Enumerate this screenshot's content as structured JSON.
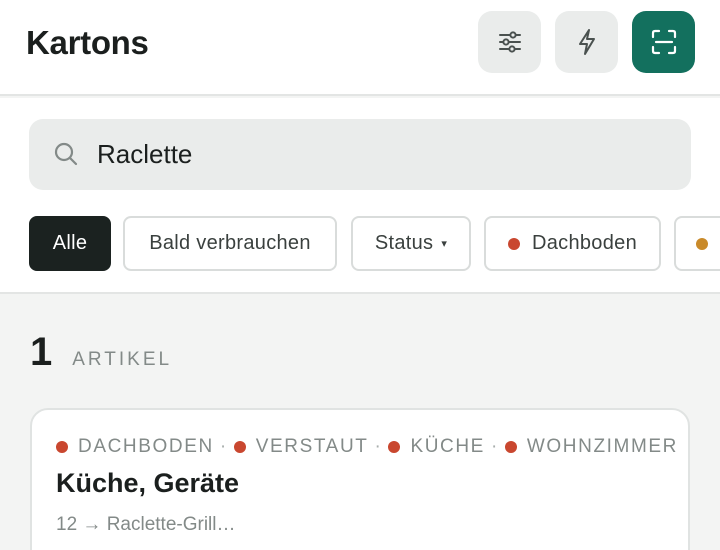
{
  "header": {
    "title": "Kartons",
    "buttons": [
      {
        "icon": "sliders-icon"
      },
      {
        "icon": "lightning-icon"
      },
      {
        "icon": "scan-icon",
        "accent": "#13705e"
      }
    ]
  },
  "search": {
    "value": "Raclette",
    "icon": "search-icon"
  },
  "filters": [
    {
      "label": "Alle",
      "active": true
    },
    {
      "label": "Bald verbrauchen"
    },
    {
      "label": "Status",
      "has_dropdown": true,
      "caret": "▾"
    },
    {
      "label": "Dachboden",
      "dot_color": "#c9472f"
    },
    {
      "label": "",
      "dot_color": "#c98a2a"
    }
  ],
  "results": {
    "count": "1",
    "label": "ARTIKEL"
  },
  "item": {
    "tags": [
      {
        "label": "DACHBODEN",
        "color": "#c9472f"
      },
      {
        "label": "VERSTAUT",
        "color": "#c9472f"
      },
      {
        "label": "KÜCHE",
        "color": "#c9472f"
      },
      {
        "label": "WOHNZIMMER",
        "color": "#c9472f"
      }
    ],
    "separator": "·",
    "title": "Küche, Geräte",
    "subtitle": "12 → Raclette-Grill…"
  }
}
